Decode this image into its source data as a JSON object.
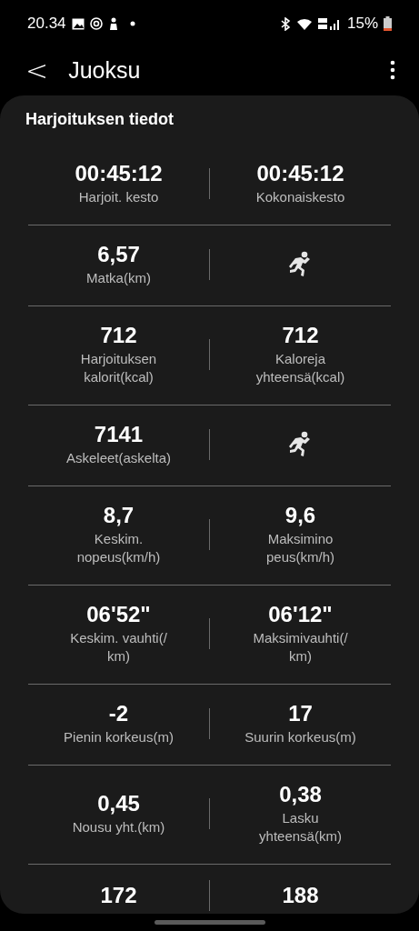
{
  "status_bar": {
    "time": "20.34",
    "battery": "15%"
  },
  "header": {
    "back": "<",
    "title": "Juoksu"
  },
  "card": {
    "title": "Harjoituksen tiedot",
    "rows": [
      {
        "cells": [
          {
            "kind": "stat",
            "value": "00:45:12",
            "label_lines": [
              "Harjoit. kesto"
            ]
          },
          {
            "kind": "stat",
            "value": "00:45:12",
            "label_lines": [
              "Kokonaiskesto"
            ]
          }
        ]
      },
      {
        "cells": [
          {
            "kind": "stat",
            "value": "6,57",
            "label_lines": [
              "Matka(km)"
            ]
          },
          {
            "kind": "icon"
          }
        ]
      },
      {
        "cells": [
          {
            "kind": "stat",
            "value": "712",
            "label_lines": [
              "Harjoituksen",
              "kalorit(kcal)"
            ]
          },
          {
            "kind": "stat",
            "value": "712",
            "label_lines": [
              "Kaloreja",
              "yhteensä(kcal)"
            ]
          }
        ]
      },
      {
        "cells": [
          {
            "kind": "stat",
            "value": "7141",
            "label_lines": [
              "Askeleet(askelta)"
            ]
          },
          {
            "kind": "icon"
          }
        ]
      },
      {
        "cells": [
          {
            "kind": "stat",
            "value": "8,7",
            "label_lines": [
              "Keskim.",
              "nopeus(km/h)"
            ]
          },
          {
            "kind": "stat",
            "value": "9,6",
            "label_lines": [
              "Maksimino",
              "peus(km/h)"
            ]
          }
        ]
      },
      {
        "cells": [
          {
            "kind": "stat",
            "value": "06'52\"",
            "label_lines": [
              "Keskim. vauhti(/",
              "km)"
            ]
          },
          {
            "kind": "stat",
            "value": "06'12\"",
            "label_lines": [
              "Maksimivauhti(/",
              "km)"
            ]
          }
        ]
      },
      {
        "cells": [
          {
            "kind": "stat",
            "value": "-2",
            "label_lines": [
              "Pienin korkeus(m)"
            ]
          },
          {
            "kind": "stat",
            "value": "17",
            "label_lines": [
              "Suurin korkeus(m)"
            ]
          }
        ]
      },
      {
        "cells": [
          {
            "kind": "stat",
            "value": "0,45",
            "label_lines": [
              "Nousu yht.(km)"
            ]
          },
          {
            "kind": "stat",
            "value": "0,38",
            "label_lines": [
              "Lasku",
              "yhteensä(km)"
            ]
          }
        ]
      },
      {
        "cells": [
          {
            "kind": "stat",
            "value": "172"
          },
          {
            "kind": "stat",
            "value": "188"
          }
        ]
      }
    ]
  }
}
